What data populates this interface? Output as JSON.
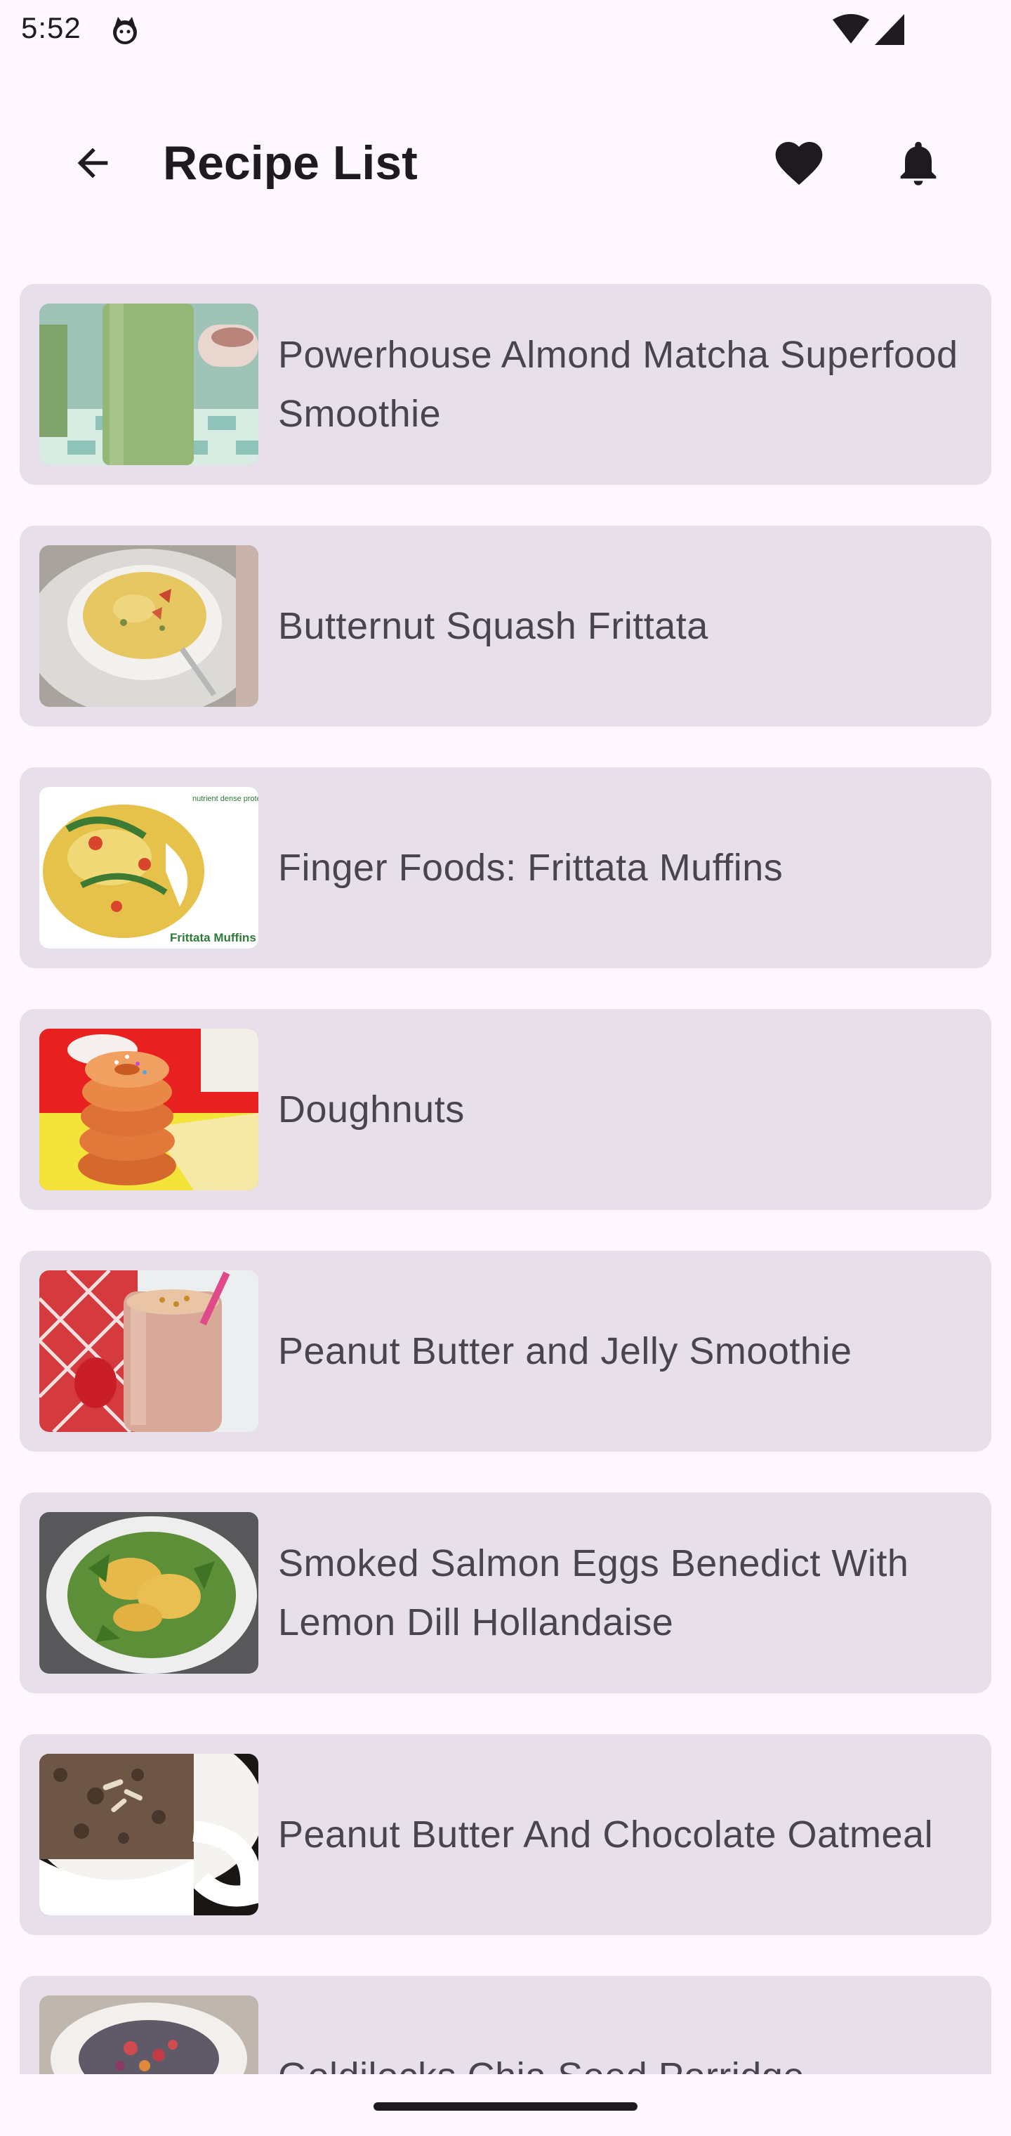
{
  "status_bar": {
    "time": "5:52",
    "icons": [
      "cat-icon",
      "wifi-icon",
      "signal-icon"
    ]
  },
  "app_bar": {
    "title": "Recipe List",
    "back_icon": "arrow-back-icon",
    "favorite_icon": "heart-icon",
    "notifications_icon": "bell-icon"
  },
  "recipes": [
    {
      "title": "Powerhouse Almond Matcha Superfood Smoothie",
      "thumb": "matcha-smoothie"
    },
    {
      "title": "Butternut Squash Frittata",
      "thumb": "frittata-ramekin"
    },
    {
      "title": "Finger Foods: Frittata Muffins",
      "thumb": "frittata-muffin"
    },
    {
      "title": "Doughnuts",
      "thumb": "doughnut-stack"
    },
    {
      "title": "Peanut Butter and Jelly Smoothie",
      "thumb": "pbj-smoothie"
    },
    {
      "title": "Smoked Salmon Eggs Benedict With Lemon Dill Hollandaise",
      "thumb": "eggs-benedict"
    },
    {
      "title": "Peanut Butter And Chocolate Oatmeal",
      "thumb": "chocolate-oatmeal"
    },
    {
      "title": "Goldilocks Chia Seed Porridge",
      "thumb": "chia-porridge"
    }
  ],
  "thumb_captions": {
    "muffin_headline": "nutrient dense protein-packed loaded with veggies",
    "muffin_label": "Frittata Muffins"
  },
  "colors": {
    "background": "#fef7ff",
    "card": "#e7e0eb",
    "title_text": "#1d1b20",
    "item_text": "#49454f"
  }
}
